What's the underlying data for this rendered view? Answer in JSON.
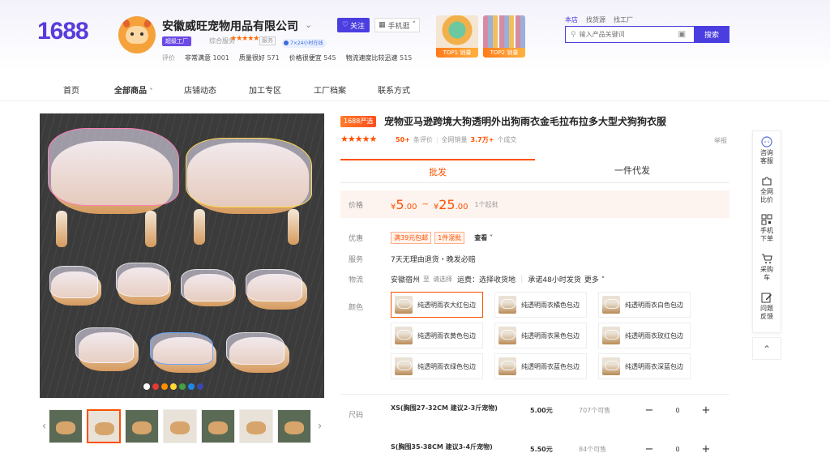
{
  "header": {
    "logo": "1688",
    "shop_name": "安徽威旺宠物用品有限公司",
    "follow": "关注",
    "mobile_shop": "手机逛",
    "factory_badge": "超级工厂",
    "service_label": "综合服务",
    "service_stars": "★★★★★",
    "service_tag": "服务",
    "service_247": "7×24小时在线",
    "ratings_label": "评价",
    "ratings": [
      {
        "label": "非常满意",
        "value": "1001"
      },
      {
        "label": "质量很好",
        "value": "571"
      },
      {
        "label": "价格很便宜",
        "value": "545"
      },
      {
        "label": "物流速度比较迅速",
        "value": "515"
      }
    ],
    "top_items": [
      "TOP1 销量",
      "TOP2 销量"
    ],
    "search_tabs": [
      "本店",
      "找货源",
      "找工厂"
    ],
    "search_placeholder": "输入产品关键词",
    "search_button": "搜索"
  },
  "nav": {
    "items": [
      "首页",
      "全部商品",
      "店铺动态",
      "加工专区",
      "工厂档案",
      "联系方式"
    ]
  },
  "gallery": {
    "dot_colors": [
      "#ffffff",
      "#e53935",
      "#ff8f00",
      "#fdd835",
      "#43a047",
      "#1e88e5",
      "#3949ab"
    ],
    "thumb_count": 7,
    "active_thumb": 2
  },
  "product": {
    "badge": "1688严选",
    "title": "宠物亚马逊跨境大狗透明外出狗雨衣金毛拉布拉多大型犬狗狗衣服",
    "stars": "★★★★★",
    "reviews": "50+",
    "reviews_suffix": "条评价",
    "sales_label": "全网销量",
    "sales": "3.7万+",
    "sales_suffix": "个成交",
    "report": "举报",
    "tabs": [
      "批发",
      "一件代发"
    ],
    "active_tab": 0,
    "price_label": "价格",
    "price_low_symbol": "¥",
    "price_low_int": "5",
    "price_low_dec": ".00",
    "price_sep": "~",
    "price_high_symbol": "¥",
    "price_high_int": "25",
    "price_high_dec": ".00",
    "moq": "1个起批",
    "promo_label": "优惠",
    "promos": [
      "满39元包邮",
      "1件混批"
    ],
    "promo_view": "查看",
    "service_label": "服务",
    "service_text": "7天无理由退货・晚发必赔",
    "logistics_label": "物流",
    "origin": "安徽宿州",
    "to": "至",
    "choose": "请选择",
    "freight": "运费：选择收货地",
    "ship_promise": "承诺48小时发货",
    "more": "更多",
    "color_label": "颜色",
    "colors": [
      "纯透明雨衣大红包边",
      "纯透明雨衣橘色包边",
      "纯透明雨衣白色包边",
      "纯透明雨衣黄色包边",
      "纯透明雨衣黑色包边",
      "纯透明雨衣玫红包边",
      "纯透明雨衣绿色包边",
      "纯透明雨衣蓝色包边",
      "纯透明雨衣深蓝包边"
    ],
    "selected_color": 0,
    "size_label": "尺码",
    "sizes": [
      {
        "name": "XS(胸围27-32CM 建议2-3斤宠物)",
        "price": "5.00元",
        "stock": "707个可售",
        "qty": "0"
      },
      {
        "name": "S(胸围35-38CM 建议3-4斤宠物)",
        "price": "5.50元",
        "stock": "84个可售",
        "qty": "0"
      }
    ]
  },
  "toolbar": {
    "items": [
      "咨询客服",
      "全网比价",
      "手机下单",
      "采购车",
      "问题反馈"
    ]
  },
  "colors": {
    "brand": "#4a3ee0",
    "accent": "#ff5000"
  }
}
